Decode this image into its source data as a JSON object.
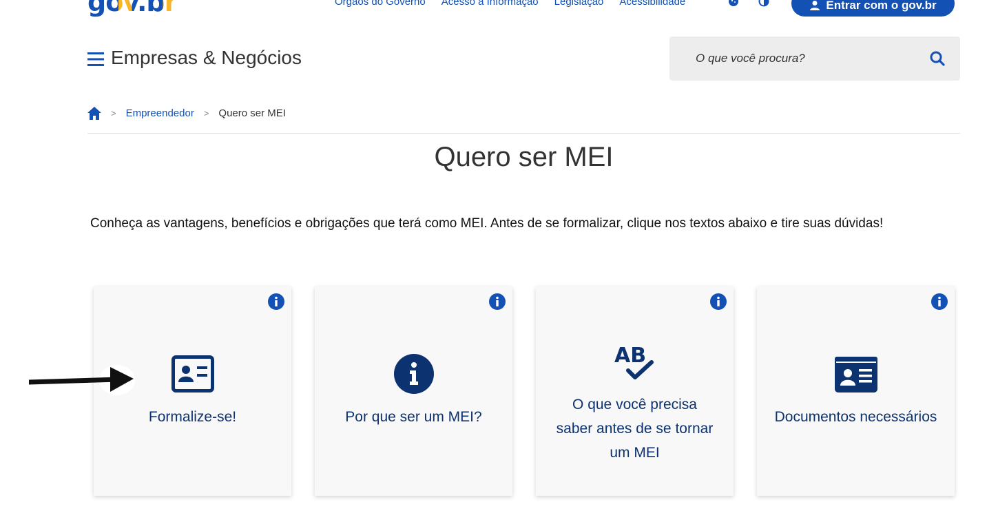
{
  "header": {
    "logo_text": "gov.br",
    "links": [
      "Órgãos do Governo",
      "Acesso à Informação",
      "Legislação",
      "Acessibilidade"
    ],
    "login_label": "Entrar com o gov.br",
    "site_title": "Empresas & Negócios",
    "search_placeholder": "O que você procura?"
  },
  "breadcrumb": {
    "items": [
      "Empreendedor",
      "Quero ser MEI"
    ]
  },
  "main": {
    "title": "Quero ser MEI",
    "intro": "Conheça as vantagens, benefícios e obrigações que terá como MEI. Antes de se formalizar, clique nos textos abaixo e tire suas dúvidas!"
  },
  "cards": [
    {
      "label": "Formalize-se!",
      "icon": "id-card-icon"
    },
    {
      "label": "Por que ser um MEI?",
      "icon": "info-circle-icon"
    },
    {
      "label_lines": [
        "O que você precisa",
        "saber antes de se tornar",
        "um MEI"
      ],
      "icon": "ab-check-icon"
    },
    {
      "label": "Documentos necessários",
      "icon": "document-card-icon"
    }
  ],
  "colors": {
    "primary": "#1351b4",
    "dark_blue": "#0c326f",
    "card_bg": "#f8f8f8",
    "search_bg": "#ededed"
  }
}
